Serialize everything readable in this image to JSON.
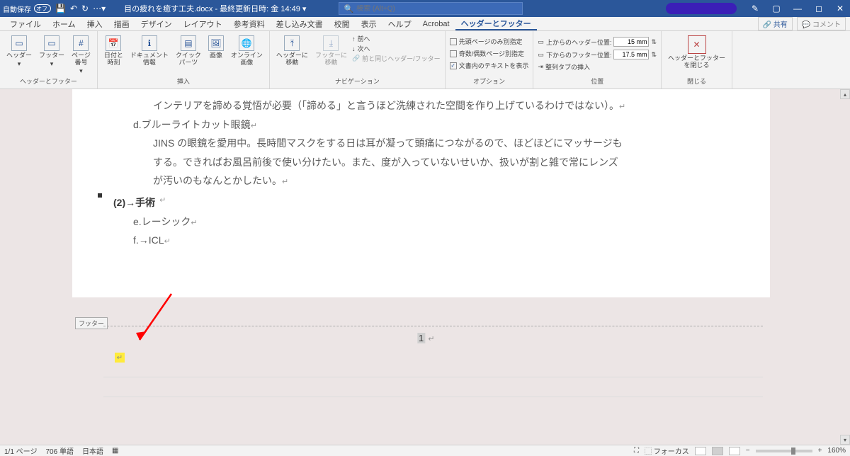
{
  "titlebar": {
    "autosave_label": "自動保存",
    "autosave_state": "オフ",
    "doc_title": "目の疲れを癒す工夫.docx - 最終更新日時: 金 14:49 ▾",
    "search_placeholder": "検索 (Alt+Q)"
  },
  "menu": {
    "tabs": [
      "ファイル",
      "ホーム",
      "挿入",
      "描画",
      "デザイン",
      "レイアウト",
      "参考資料",
      "差し込み文書",
      "校閲",
      "表示",
      "ヘルプ",
      "Acrobat",
      "ヘッダーとフッター"
    ],
    "active": 12,
    "share": "共有",
    "comment": "コメント"
  },
  "ribbon": {
    "group_hf": {
      "label": "ヘッダーとフッター",
      "header": "ヘッダー",
      "footer": "フッター",
      "pagenum": "ページ\n番号"
    },
    "group_insert": {
      "label": "挿入",
      "datetime": "日付と\n時刻",
      "docinfo": "ドキュメント\n情報",
      "quick": "クイック\nパーツ",
      "image": "画像",
      "online": "オンライン\n画像"
    },
    "group_nav": {
      "label": "ナビゲーション",
      "goto_header": "ヘッダーに\n移動",
      "goto_footer": "フッターに\n移動",
      "prev": "前へ",
      "next": "次へ",
      "link": "前と同じヘッダー/フッター"
    },
    "group_options": {
      "label": "オプション",
      "first_page": "先頭ページのみ別指定",
      "odd_even": "奇数/偶数ページ別指定",
      "show_text": "文書内のテキストを表示"
    },
    "group_position": {
      "label": "位置",
      "top": "上からのヘッダー位置:",
      "top_val": "15 mm",
      "bottom": "下からのフッター位置:",
      "bottom_val": "17.5 mm",
      "align_tab": "整列タブの挿入"
    },
    "group_close": {
      "label": "閉じる",
      "btn": "ヘッダーとフッター\nを閉じる"
    }
  },
  "doc": {
    "l1": "インテリアを諦める覚悟が必要（「諦める」と言うほど洗練された空間を作り上げているわけではない）。",
    "h_d": "d.ブルーライトカット眼鏡",
    "l2a": "JINS の眼鏡を愛用中。長時間マスクをする日は耳が凝って頭痛につながるので、ほどほどにマッサージも",
    "l2b": "する。できればお風呂前後で使い分けたい。また、度が入っていないせいか、扱いが割と雑で常にレンズ",
    "l2c": "が汚いのもなんとかしたい。",
    "h2": "(2)→手術",
    "h_e": "e.レーシック",
    "h_f": "f.→ICL",
    "footer_label": "フッター",
    "page_number": "1"
  },
  "status": {
    "page": "1/1 ページ",
    "words": "706 単語",
    "lang": "日本語",
    "focus": "フォーカス",
    "zoom": "160%"
  }
}
